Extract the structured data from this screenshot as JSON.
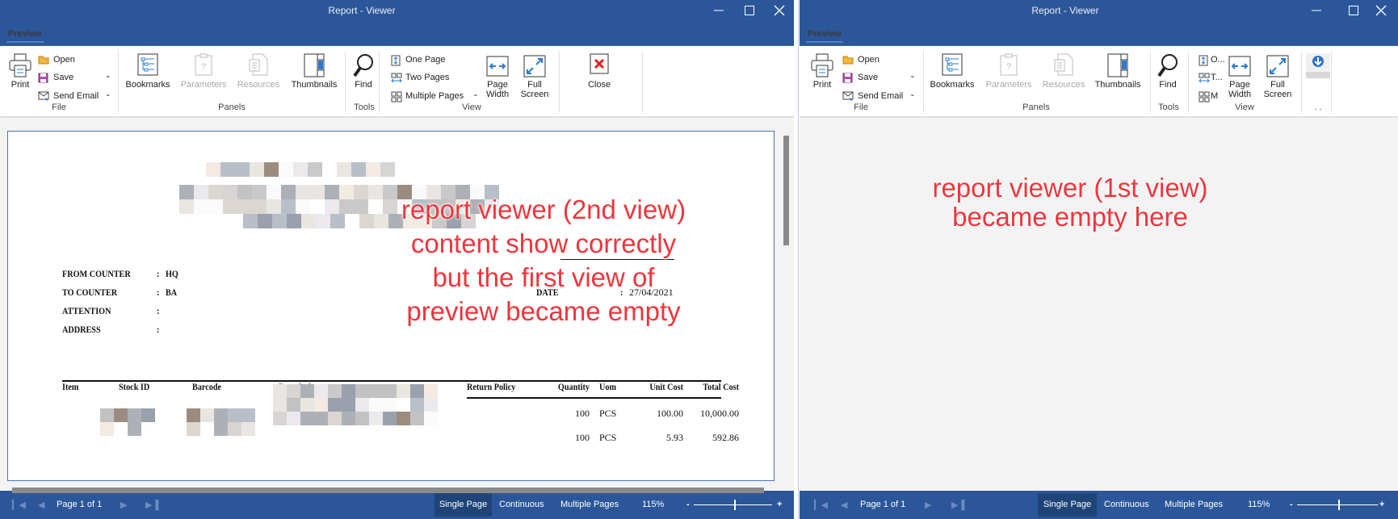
{
  "windows": [
    {
      "id": "left",
      "title": "Report - Viewer",
      "tab": "Preview",
      "ribbon": {
        "print": "Print",
        "open": "Open",
        "save": "Save",
        "send_email": "Send Email",
        "file_group": "File",
        "bookmarks": "Bookmarks",
        "parameters": "Parameters",
        "resources": "Resources",
        "thumbnails": "Thumbnails",
        "panels_group": "Panels",
        "find": "Find",
        "tools_group": "Tools",
        "one_page": "One Page",
        "two_pages": "Two Pages",
        "multiple_pages": "Multiple Pages",
        "page_width_1": "Page",
        "page_width_2": "Width",
        "full_screen_1": "Full",
        "full_screen_2": "Screen",
        "view_group": "View",
        "close": "Close"
      },
      "status": {
        "page": "Page 1 of 1",
        "single_page": "Single Page",
        "continuous": "Continuous",
        "multiple_pages": "Multiple Pages",
        "zoom": "115%",
        "zoom_minus": "-",
        "zoom_plus": "+"
      },
      "annotation": [
        "report viewer (2nd view)",
        "content show correctly",
        "but the first view of",
        "preview became empty"
      ]
    },
    {
      "id": "right",
      "title": "Report - Viewer",
      "tab": "Preview",
      "ribbon": {
        "print": "Print",
        "open": "Open",
        "save": "Save",
        "send_email": "Send Email",
        "file_group": "File",
        "bookmarks": "Bookmarks",
        "parameters": "Parameters",
        "resources": "Resources",
        "thumbnails": "Thumbnails",
        "panels_group": "Panels",
        "find": "Find",
        "tools_group": "Tools",
        "one_page": "O...",
        "two_pages": "T...",
        "multiple_pages": "M",
        "page_width_1": "Page",
        "page_width_2": "Width",
        "full_screen_1": "Full",
        "full_screen_2": "Screen",
        "view_group": "View",
        "extra_group": ". ."
      },
      "status": {
        "page": "Page 1 of 1",
        "single_page": "Single Page",
        "continuous": "Continuous",
        "multiple_pages": "Multiple Pages",
        "zoom": "115%",
        "zoom_minus": "-",
        "zoom_plus": "+"
      },
      "annotation": [
        "report viewer (1st view)",
        "became empty here"
      ]
    }
  ],
  "report": {
    "fields": [
      {
        "label": "FROM COUNTER",
        "colon": ":",
        "value": "HQ"
      },
      {
        "label": "TO COUNTER",
        "colon": ":",
        "value": "BA"
      },
      {
        "label": "ATTENTION",
        "colon": ":",
        "value": ""
      },
      {
        "label": "ADDRESS",
        "colon": ":",
        "value": ""
      }
    ],
    "date": {
      "label": "DATE",
      "colon": ":",
      "value": "27/04/2021"
    },
    "columns": [
      "Item",
      "Stock ID",
      "Barcode",
      "Description",
      "Return Policy",
      "Quantity",
      "Uom",
      "Unit Cost",
      "Total Cost"
    ],
    "rows": [
      {
        "quantity": "100",
        "uom": "PCS",
        "unit_cost": "100.00",
        "total_cost": "10,000.00"
      },
      {
        "quantity": "100",
        "uom": "PCS",
        "unit_cost": "5.93",
        "total_cost": "592.86"
      }
    ]
  },
  "colors": {
    "titlebar": "#2b579a",
    "annotation": "#f0343c",
    "page_border": "#4a72bf"
  }
}
